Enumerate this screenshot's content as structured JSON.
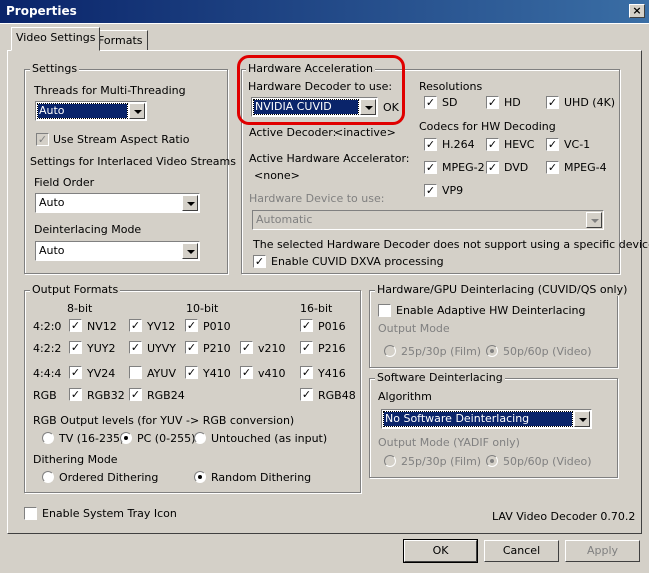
{
  "window": {
    "title": "Properties",
    "close_label": "×"
  },
  "tabs": [
    "Video Settings",
    "Formats"
  ],
  "settings": {
    "group_label": "Settings",
    "threads_label": "Threads for Multi-Threading",
    "threads_value": "Auto",
    "stream_aspect_label": "Use Stream Aspect Ratio",
    "stream_aspect_checked": true,
    "interlaced_label": "Settings for Interlaced Video Streams",
    "field_order_label": "Field Order",
    "field_order_value": "Auto",
    "deint_mode_label": "Deinterlacing Mode",
    "deint_mode_value": "Auto"
  },
  "hwaccel": {
    "group_label": "Hardware Acceleration",
    "decoder_label": "Hardware Decoder to use:",
    "decoder_value": "NVIDIA CUVID",
    "ok_label": "OK",
    "active_decoder_label": "Active Decoder:",
    "active_decoder_value": "<inactive>",
    "active_accel_label": "Active Hardware Accelerator:",
    "active_accel_value": "<none>",
    "device_label": "Hardware Device to use:",
    "device_value": "Automatic",
    "note": "The selected Hardware Decoder does not support using a specific device.",
    "dxva_label": "Enable CUVID DXVA processing",
    "resolutions_label": "Resolutions",
    "resolutions": [
      {
        "label": "SD",
        "checked": true
      },
      {
        "label": "HD",
        "checked": true
      },
      {
        "label": "UHD (4K)",
        "checked": true
      }
    ],
    "codecs_label": "Codecs for HW Decoding",
    "codecs": [
      {
        "label": "H.264",
        "checked": true
      },
      {
        "label": "HEVC",
        "checked": true
      },
      {
        "label": "VC-1",
        "checked": true
      },
      {
        "label": "MPEG-2",
        "checked": true
      },
      {
        "label": "DVD",
        "checked": true
      },
      {
        "label": "MPEG-4",
        "checked": true
      },
      {
        "label": "VP9",
        "checked": true
      }
    ]
  },
  "output": {
    "group_label": "Output Formats",
    "col_headers": [
      "8-bit",
      "10-bit",
      "16-bit"
    ],
    "row_labels": [
      "4:2:0",
      "4:2:2",
      "4:4:4",
      "RGB"
    ],
    "formats": {
      "nv12": "NV12",
      "yv12": "YV12",
      "p010": "P010",
      "p016": "P016",
      "yuy2": "YUY2",
      "uyvy": "UYVY",
      "p210": "P210",
      "v210": "v210",
      "p216": "P216",
      "yv24": "YV24",
      "ayuv": "AYUV",
      "y410": "Y410",
      "v410": "v410",
      "y416": "Y416",
      "rgb32": "RGB32",
      "rgb24": "RGB24",
      "rgb48": "RGB48"
    },
    "rgb_levels_label": "RGB Output levels (for YUV -> RGB conversion)",
    "rgb_levels": [
      "TV (16-235)",
      "PC (0-255)",
      "Untouched (as input)"
    ],
    "rgb_levels_selected": "PC (0-255)",
    "dither_label": "Dithering Mode",
    "dither": [
      "Ordered Dithering",
      "Random Dithering"
    ],
    "dither_selected": "Random Dithering"
  },
  "hwdeint": {
    "group_label": "Hardware/GPU Deinterlacing (CUVID/QS only)",
    "enable_label": "Enable Adaptive HW Deinterlacing",
    "output_mode_label": "Output Mode",
    "modes": [
      "25p/30p (Film)",
      "50p/60p (Video)"
    ]
  },
  "swdeint": {
    "group_label": "Software Deinterlacing",
    "algorithm_label": "Algorithm",
    "algorithm_value": "No Software Deinterlacing",
    "output_mode_label": "Output Mode (YADIF only)",
    "modes": [
      "25p/30p (Film)",
      "50p/60p (Video)"
    ]
  },
  "footer": {
    "tray_label": "Enable System Tray Icon",
    "version": "LAV Video Decoder 0.70.2"
  },
  "buttons": {
    "ok": "OK",
    "cancel": "Cancel",
    "apply": "Apply"
  },
  "colors": {
    "title_bar": "#0a246a",
    "face": "#d4d0c8",
    "highlight_ring": "#e00000",
    "selection": "#0a246a"
  }
}
